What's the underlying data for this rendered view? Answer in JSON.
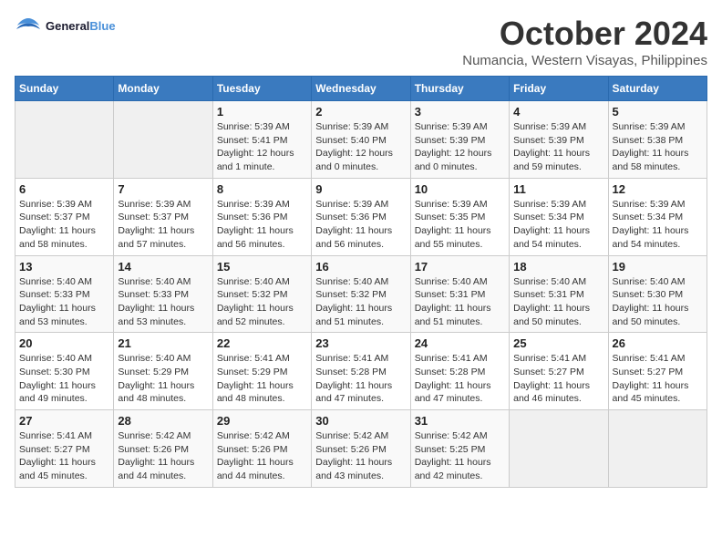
{
  "logo": {
    "text_general": "General",
    "text_blue": "Blue"
  },
  "header": {
    "month": "October 2024",
    "location": "Numancia, Western Visayas, Philippines"
  },
  "weekdays": [
    "Sunday",
    "Monday",
    "Tuesday",
    "Wednesday",
    "Thursday",
    "Friday",
    "Saturday"
  ],
  "weeks": [
    [
      {
        "day": "",
        "info": ""
      },
      {
        "day": "",
        "info": ""
      },
      {
        "day": "1",
        "info": "Sunrise: 5:39 AM\nSunset: 5:41 PM\nDaylight: 12 hours and 1 minute."
      },
      {
        "day": "2",
        "info": "Sunrise: 5:39 AM\nSunset: 5:40 PM\nDaylight: 12 hours and 0 minutes."
      },
      {
        "day": "3",
        "info": "Sunrise: 5:39 AM\nSunset: 5:39 PM\nDaylight: 12 hours and 0 minutes."
      },
      {
        "day": "4",
        "info": "Sunrise: 5:39 AM\nSunset: 5:39 PM\nDaylight: 11 hours and 59 minutes."
      },
      {
        "day": "5",
        "info": "Sunrise: 5:39 AM\nSunset: 5:38 PM\nDaylight: 11 hours and 58 minutes."
      }
    ],
    [
      {
        "day": "6",
        "info": "Sunrise: 5:39 AM\nSunset: 5:37 PM\nDaylight: 11 hours and 58 minutes."
      },
      {
        "day": "7",
        "info": "Sunrise: 5:39 AM\nSunset: 5:37 PM\nDaylight: 11 hours and 57 minutes."
      },
      {
        "day": "8",
        "info": "Sunrise: 5:39 AM\nSunset: 5:36 PM\nDaylight: 11 hours and 56 minutes."
      },
      {
        "day": "9",
        "info": "Sunrise: 5:39 AM\nSunset: 5:36 PM\nDaylight: 11 hours and 56 minutes."
      },
      {
        "day": "10",
        "info": "Sunrise: 5:39 AM\nSunset: 5:35 PM\nDaylight: 11 hours and 55 minutes."
      },
      {
        "day": "11",
        "info": "Sunrise: 5:39 AM\nSunset: 5:34 PM\nDaylight: 11 hours and 54 minutes."
      },
      {
        "day": "12",
        "info": "Sunrise: 5:39 AM\nSunset: 5:34 PM\nDaylight: 11 hours and 54 minutes."
      }
    ],
    [
      {
        "day": "13",
        "info": "Sunrise: 5:40 AM\nSunset: 5:33 PM\nDaylight: 11 hours and 53 minutes."
      },
      {
        "day": "14",
        "info": "Sunrise: 5:40 AM\nSunset: 5:33 PM\nDaylight: 11 hours and 53 minutes."
      },
      {
        "day": "15",
        "info": "Sunrise: 5:40 AM\nSunset: 5:32 PM\nDaylight: 11 hours and 52 minutes."
      },
      {
        "day": "16",
        "info": "Sunrise: 5:40 AM\nSunset: 5:32 PM\nDaylight: 11 hours and 51 minutes."
      },
      {
        "day": "17",
        "info": "Sunrise: 5:40 AM\nSunset: 5:31 PM\nDaylight: 11 hours and 51 minutes."
      },
      {
        "day": "18",
        "info": "Sunrise: 5:40 AM\nSunset: 5:31 PM\nDaylight: 11 hours and 50 minutes."
      },
      {
        "day": "19",
        "info": "Sunrise: 5:40 AM\nSunset: 5:30 PM\nDaylight: 11 hours and 50 minutes."
      }
    ],
    [
      {
        "day": "20",
        "info": "Sunrise: 5:40 AM\nSunset: 5:30 PM\nDaylight: 11 hours and 49 minutes."
      },
      {
        "day": "21",
        "info": "Sunrise: 5:40 AM\nSunset: 5:29 PM\nDaylight: 11 hours and 48 minutes."
      },
      {
        "day": "22",
        "info": "Sunrise: 5:41 AM\nSunset: 5:29 PM\nDaylight: 11 hours and 48 minutes."
      },
      {
        "day": "23",
        "info": "Sunrise: 5:41 AM\nSunset: 5:28 PM\nDaylight: 11 hours and 47 minutes."
      },
      {
        "day": "24",
        "info": "Sunrise: 5:41 AM\nSunset: 5:28 PM\nDaylight: 11 hours and 47 minutes."
      },
      {
        "day": "25",
        "info": "Sunrise: 5:41 AM\nSunset: 5:27 PM\nDaylight: 11 hours and 46 minutes."
      },
      {
        "day": "26",
        "info": "Sunrise: 5:41 AM\nSunset: 5:27 PM\nDaylight: 11 hours and 45 minutes."
      }
    ],
    [
      {
        "day": "27",
        "info": "Sunrise: 5:41 AM\nSunset: 5:27 PM\nDaylight: 11 hours and 45 minutes."
      },
      {
        "day": "28",
        "info": "Sunrise: 5:42 AM\nSunset: 5:26 PM\nDaylight: 11 hours and 44 minutes."
      },
      {
        "day": "29",
        "info": "Sunrise: 5:42 AM\nSunset: 5:26 PM\nDaylight: 11 hours and 44 minutes."
      },
      {
        "day": "30",
        "info": "Sunrise: 5:42 AM\nSunset: 5:26 PM\nDaylight: 11 hours and 43 minutes."
      },
      {
        "day": "31",
        "info": "Sunrise: 5:42 AM\nSunset: 5:25 PM\nDaylight: 11 hours and 42 minutes."
      },
      {
        "day": "",
        "info": ""
      },
      {
        "day": "",
        "info": ""
      }
    ]
  ]
}
